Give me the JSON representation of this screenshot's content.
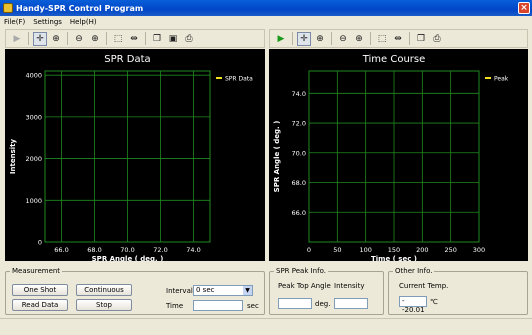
{
  "window": {
    "title": "Handy-SPR Control Program"
  },
  "menu": {
    "items": [
      "File(F)",
      "Settings",
      "Help(H)"
    ]
  },
  "left_panel": {
    "chart_data": {
      "type": "line",
      "title": "SPR Data",
      "xlabel": "SPR Angle ( deg. )",
      "ylabel": "Intensity",
      "xlim": [
        65.0,
        75.0
      ],
      "ylim": [
        0,
        4100
      ],
      "xticks": [
        66.0,
        68.0,
        70.0,
        72.0,
        74.0
      ],
      "yticks": [
        0,
        1000,
        2000,
        3000,
        4000
      ],
      "xtick_labels": [
        "66.0",
        "68.0",
        "70.0",
        "72.0",
        "74.0"
      ],
      "ytick_labels": [
        "0",
        "1000",
        "2000",
        "3000",
        "4000"
      ],
      "grid": true,
      "legend": "top-right",
      "series": [
        {
          "name": "SPR Data",
          "color": "#f0e020",
          "x": [],
          "y": []
        }
      ]
    }
  },
  "right_panel": {
    "chart_data": {
      "type": "line",
      "title": "Time Course",
      "xlabel": "Time ( sec )",
      "ylabel": "SPR Angle ( deg. )",
      "xlim": [
        0,
        300
      ],
      "ylim": [
        64.0,
        75.5
      ],
      "xticks": [
        0,
        50,
        100,
        150,
        200,
        250,
        300
      ],
      "yticks": [
        66.0,
        68.0,
        70.0,
        72.0,
        74.0
      ],
      "xtick_labels": [
        "0",
        "50",
        "100",
        "150",
        "200",
        "250",
        "300"
      ],
      "ytick_labels": [
        "66.0",
        "68.0",
        "70.0",
        "72.0",
        "74.0"
      ],
      "grid": true,
      "legend": "top-right",
      "series": [
        {
          "name": "Peak",
          "color": "#f0e020",
          "x": [],
          "y": []
        }
      ]
    }
  },
  "measurement": {
    "legend": "Measurement",
    "one_shot": "One Shot",
    "continuous": "Continuous",
    "read_data": "Read Data",
    "stop": "Stop",
    "interval_label": "Interval",
    "interval_value": "0 sec",
    "time_label": "Time",
    "time_value": "",
    "time_unit": "sec"
  },
  "peak_info": {
    "legend": "SPR Peak Info.",
    "peak_top_angle_label": "Peak Top Angle",
    "intensity_label": "Intensity",
    "peak_value": "",
    "deg_unit": "deg.",
    "intensity_value": ""
  },
  "other_info": {
    "legend": "Other Info.",
    "current_temp_label": "Current Temp.",
    "temp_value": "--20.01",
    "temp_unit": "℃"
  },
  "colors": {
    "plot_bg": "#000000",
    "grid": "#1f8a1f",
    "axis_text": "#ffffff",
    "series": "#f0e020"
  }
}
